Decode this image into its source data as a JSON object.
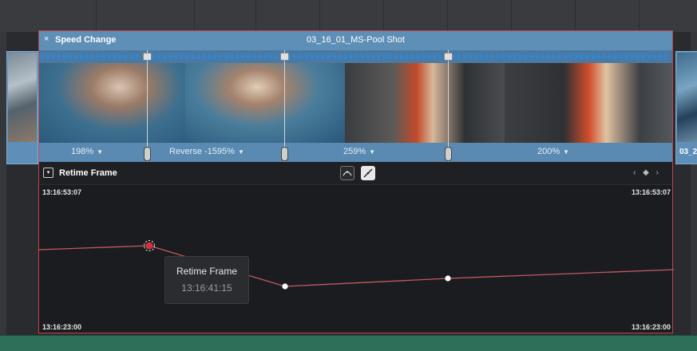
{
  "editor": {
    "close_glyph": "×",
    "title": "Speed Change",
    "clip_name": "03_16_01_MS-Pool Shot"
  },
  "neighbor_clip_right": {
    "label": "03_2"
  },
  "speed_segments": [
    {
      "label": "198%"
    },
    {
      "label": "Reverse -1595%"
    },
    {
      "label": "259%"
    },
    {
      "label": "200%"
    }
  ],
  "curve": {
    "collapse_glyph": "▾",
    "title": "Retime Frame",
    "tool_icons": [
      "bezier-curve-icon",
      "linear-curve-icon"
    ],
    "keyframe_nav": "‹ ◆ ›",
    "tc_top_left": "13:16:53:07",
    "tc_top_right": "13:16:53:07",
    "tc_bottom_left": "13:16:23:00",
    "tc_bottom_right": "13:16:23:00"
  },
  "tooltip": {
    "title": "Retime Frame",
    "value": "13:16:41:15"
  },
  "colors": {
    "accent_red": "#c0434b",
    "header_blue": "#5e8fb7",
    "arrow_blue": "#4a7aa3",
    "timeline_green": "#2e6f5a",
    "curve_line": "#c25a5f"
  }
}
